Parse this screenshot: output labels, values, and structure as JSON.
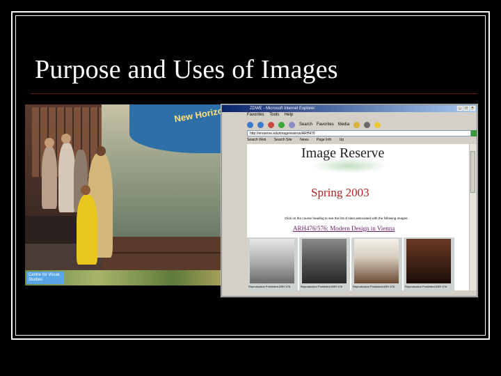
{
  "slide": {
    "title": "Purpose and Uses of Images"
  },
  "photo": {
    "exhibit_title": "New Horizons",
    "logo_text": "Centre for Visual Studies"
  },
  "browser": {
    "window_title": "ZDWE - Microsoft Internet Explorer",
    "menu": [
      "Favorites",
      "Tools",
      "Help"
    ],
    "toolbar": [
      "Search",
      "Favorites",
      "Media"
    ],
    "address": "http://ereserve.edu/imagereserve/ARH476",
    "links": [
      "Search Web",
      "Search Site",
      "News",
      "Page Info",
      "Up"
    ],
    "page": {
      "heading": "Image Reserve",
      "semester": "Spring 2003",
      "instructions": "Click on the course heading to see the list of sites associated with the following images.",
      "course_link": "ARH476/576: Modern Design in Vienna",
      "thumbnails": [
        {
          "caption": "Reproduction Prohibited ARH 476"
        },
        {
          "caption": "Reproduction Prohibited ARH 476"
        },
        {
          "caption": "Reproduction Prohibited ARH 476"
        },
        {
          "caption": "Reproduction Prohibited ARH 476"
        }
      ]
    }
  }
}
